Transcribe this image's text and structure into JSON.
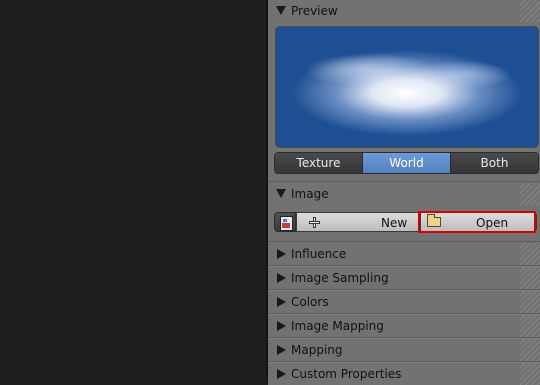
{
  "panels": {
    "preview": {
      "label": "Preview"
    },
    "image": {
      "label": "Image"
    },
    "influence": {
      "label": "Influence"
    },
    "image_sampling": {
      "label": "Image Sampling"
    },
    "colors": {
      "label": "Colors"
    },
    "image_mapping": {
      "label": "Image Mapping"
    },
    "mapping": {
      "label": "Mapping"
    },
    "custom_properties": {
      "label": "Custom Properties"
    }
  },
  "preview_tabs": {
    "options": [
      "Texture",
      "World",
      "Both"
    ],
    "selected": "World"
  },
  "image_controls": {
    "new_label": "New",
    "open_label": "Open"
  },
  "colors": {
    "accent": "#5a86c8",
    "highlight": "#d40000"
  }
}
